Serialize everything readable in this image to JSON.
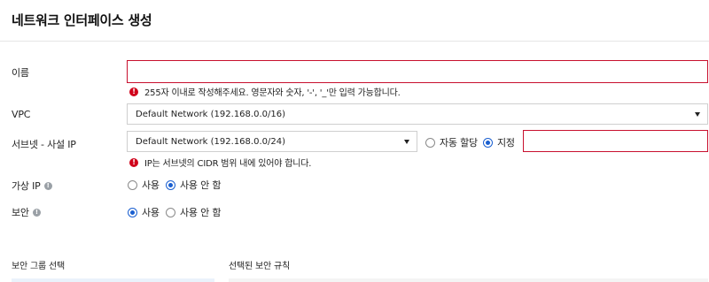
{
  "page": {
    "title": "네트워크 인터페이스 생성"
  },
  "form": {
    "name": {
      "label": "이름",
      "value": "",
      "error": "255자 이내로 작성해주세요. 영문자와 숫자, '-', '_'만 입력 가능합니다."
    },
    "vpc": {
      "label": "VPC",
      "selected": "Default Network (192.168.0.0/16)"
    },
    "subnet": {
      "label": "서브넷 - 사설 IP",
      "selected": "Default Network (192.168.0.0/24)",
      "auto_label": "자동 할당",
      "manual_label": "지정",
      "selected_mode": "manual",
      "ip_value": "",
      "error": "IP는 서브넷의 CIDR 범위 내에 있어야 합니다."
    },
    "floating_ip": {
      "label": "가상 IP",
      "option_use": "사용",
      "option_not_use": "사용 안 함",
      "selected": "not_use"
    },
    "security": {
      "label": "보안",
      "option_use": "사용",
      "option_not_use": "사용 안 함",
      "selected": "use"
    }
  },
  "sections": {
    "security_group_select": "보안 그룹 선택",
    "selected_security_rules": "선택된 보안 규칙"
  },
  "icons": {
    "error": "error-icon",
    "info": "info-icon",
    "dropdown": "chevron-down-icon"
  },
  "colors": {
    "error": "#d0021b",
    "input_error_border": "#c8102e",
    "radio_selected": "#1a5fd0",
    "panel_bg": "#eaf2fb"
  }
}
